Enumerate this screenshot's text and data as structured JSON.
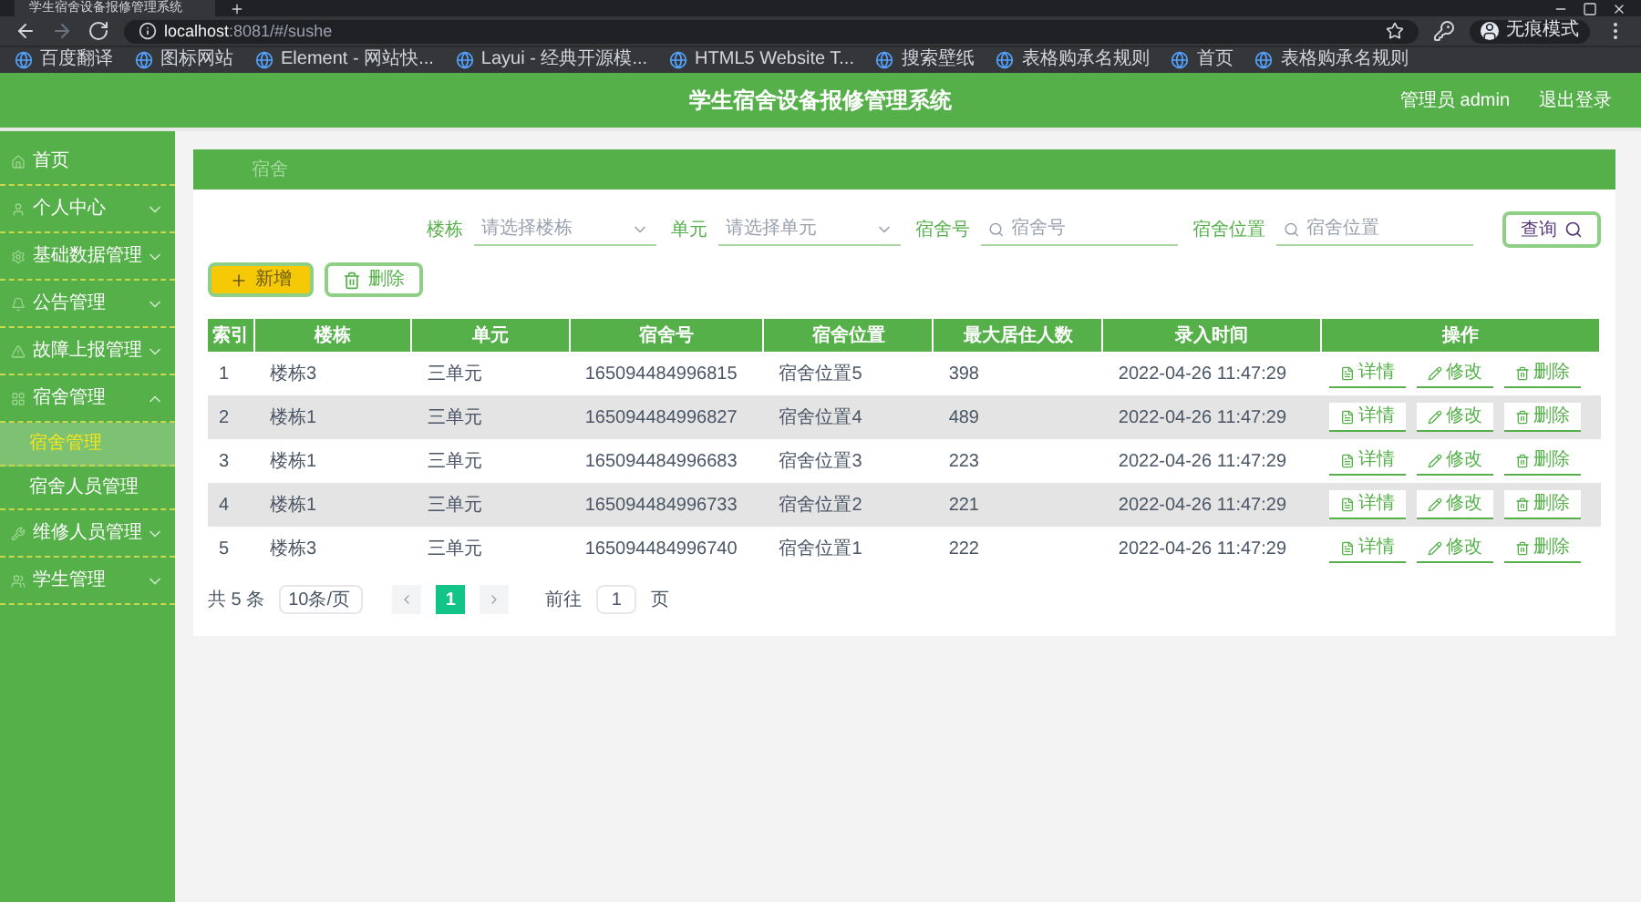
{
  "browser": {
    "tab_title": "学生宿舍设备报修管理系统",
    "url_host": "localhost",
    "url_rest": ":8081/#/sushe",
    "profile_label": "无痕模式",
    "bookmarks": [
      {
        "label": "百度翻译"
      },
      {
        "label": "图标网站"
      },
      {
        "label": "Element - 网站快..."
      },
      {
        "label": "Layui - 经典开源模..."
      },
      {
        "label": "HTML5 Website T..."
      },
      {
        "label": "搜索壁纸"
      },
      {
        "label": "表格购承名规则"
      },
      {
        "label": "首页"
      },
      {
        "label": "表格购承名规则"
      }
    ]
  },
  "header": {
    "title": "学生宿舍设备报修管理系统",
    "user": "管理员 admin",
    "logout": "退出登录"
  },
  "sidebar": {
    "items": [
      {
        "kind": "link",
        "label": "首页"
      },
      {
        "kind": "menu",
        "label": "个人中心",
        "expanded": false
      },
      {
        "kind": "menu",
        "label": "基础数据管理",
        "expanded": false
      },
      {
        "kind": "menu",
        "label": "公告管理",
        "expanded": false
      },
      {
        "kind": "menu",
        "label": "故障上报管理",
        "expanded": false
      },
      {
        "kind": "menu",
        "label": "宿舍管理",
        "expanded": true,
        "children": [
          {
            "label": "宿舍管理",
            "selected": true
          },
          {
            "label": "宿舍人员管理",
            "selected": false
          }
        ]
      },
      {
        "kind": "menu",
        "label": "维修人员管理",
        "expanded": false
      },
      {
        "kind": "menu",
        "label": "学生管理",
        "expanded": false
      }
    ]
  },
  "breadcrumb": "宿舍",
  "search": {
    "fields": [
      {
        "kind": "select",
        "label": "楼栋",
        "placeholder": "请选择楼栋"
      },
      {
        "kind": "select",
        "label": "单元",
        "placeholder": "请选择单元"
      },
      {
        "kind": "input",
        "label": "宿舍号",
        "placeholder": "宿舍号"
      },
      {
        "kind": "input",
        "label": "宿舍位置",
        "placeholder": "宿舍位置"
      }
    ],
    "button": "查询"
  },
  "actions": {
    "add": "新增",
    "delete": "删除"
  },
  "table": {
    "columns": [
      "索引",
      "楼栋",
      "单元",
      "宿舍号",
      "宿舍位置",
      "最大居住人数",
      "录入时间",
      "操作"
    ],
    "rows": [
      {
        "cells": [
          "1",
          "楼栋3",
          "三单元",
          "165094484996815",
          "宿舍位置5",
          "398",
          "2022-04-26 11:47:29"
        ],
        "actions": [
          {
            "kind": "detail",
            "label": "详情"
          },
          {
            "kind": "edit",
            "label": "修改"
          },
          {
            "kind": "delete",
            "label": "删除"
          }
        ]
      },
      {
        "cells": [
          "2",
          "楼栋1",
          "三单元",
          "165094484996827",
          "宿舍位置4",
          "489",
          "2022-04-26 11:47:29"
        ],
        "actions": [
          {
            "kind": "detail",
            "label": "详情"
          },
          {
            "kind": "edit",
            "label": "修改"
          },
          {
            "kind": "delete",
            "label": "删除"
          }
        ]
      },
      {
        "cells": [
          "3",
          "楼栋1",
          "三单元",
          "165094484996683",
          "宿舍位置3",
          "223",
          "2022-04-26 11:47:29"
        ],
        "actions": [
          {
            "kind": "detail",
            "label": "详情"
          },
          {
            "kind": "edit",
            "label": "修改"
          },
          {
            "kind": "delete",
            "label": "删除"
          }
        ]
      },
      {
        "cells": [
          "4",
          "楼栋1",
          "三单元",
          "165094484996733",
          "宿舍位置2",
          "221",
          "2022-04-26 11:47:29"
        ],
        "actions": [
          {
            "kind": "detail",
            "label": "详情"
          },
          {
            "kind": "edit",
            "label": "修改"
          },
          {
            "kind": "delete",
            "label": "删除"
          }
        ]
      },
      {
        "cells": [
          "5",
          "楼栋3",
          "三单元",
          "165094484996740",
          "宿舍位置1",
          "222",
          "2022-04-26 11:47:29"
        ],
        "actions": [
          {
            "kind": "detail",
            "label": "详情"
          },
          {
            "kind": "edit",
            "label": "修改"
          },
          {
            "kind": "delete",
            "label": "删除"
          }
        ]
      }
    ]
  },
  "pagination": {
    "total": "共 5 条",
    "page_size": "10条/页",
    "pages": [
      {
        "label": "1",
        "selected": true
      }
    ],
    "goto_label": "前往",
    "goto_value": "1",
    "page_suffix": "页"
  }
}
